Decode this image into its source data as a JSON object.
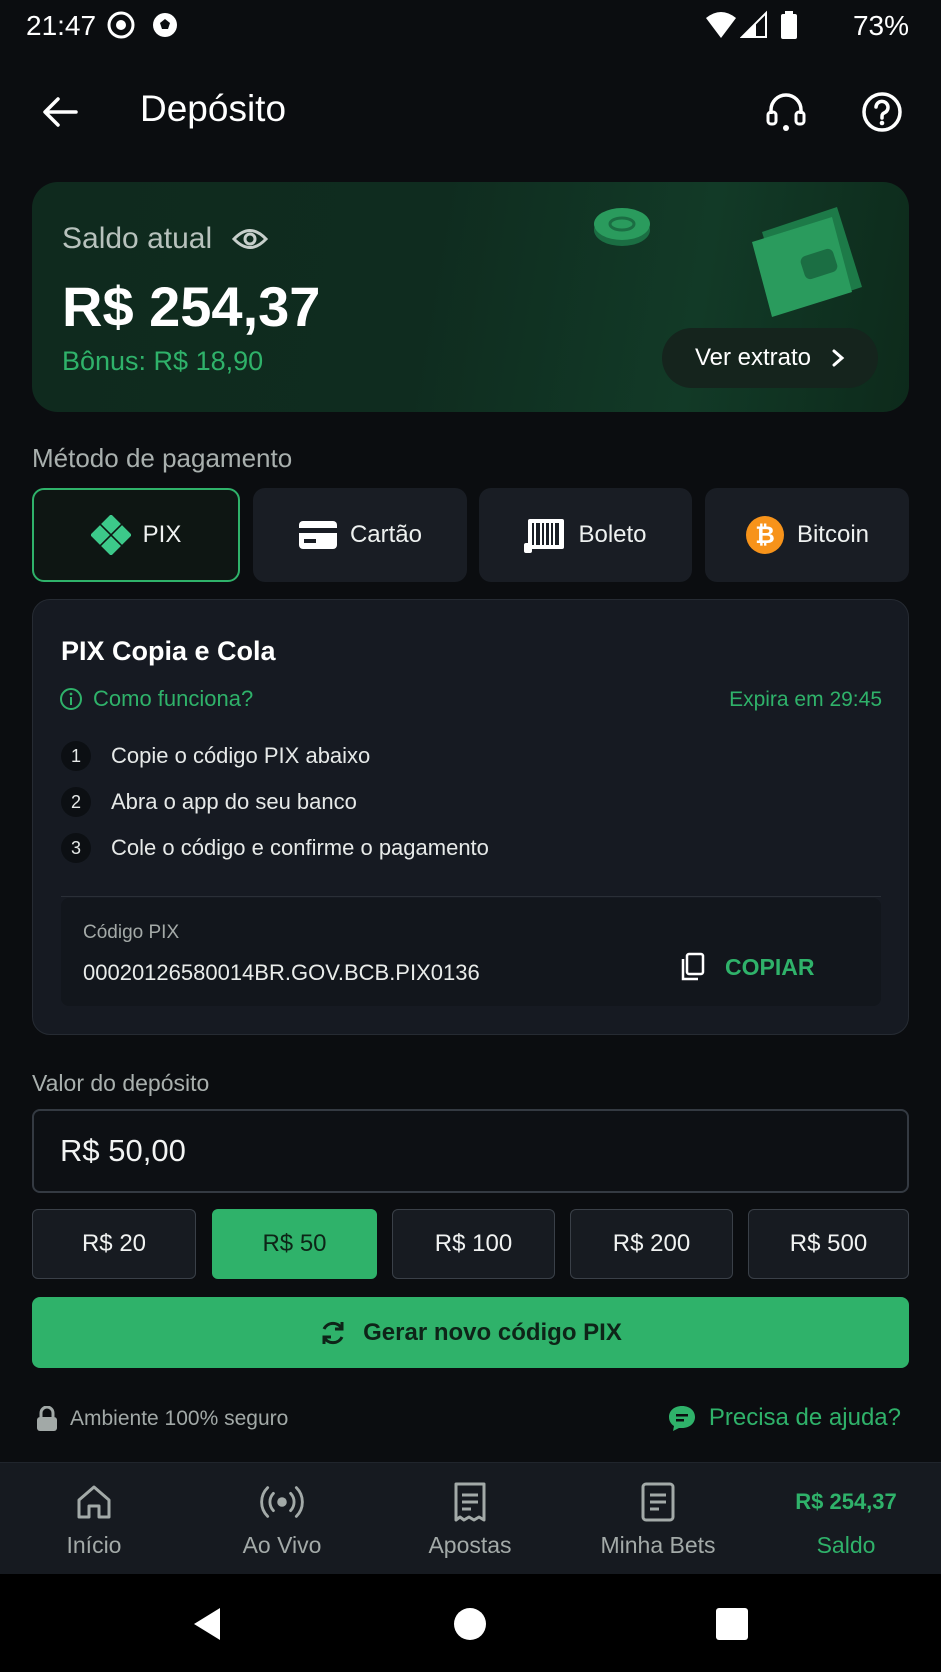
{
  "status_bar": {
    "time": "21:47",
    "battery": "73%"
  },
  "header": {
    "title": "Depósito"
  },
  "balance": {
    "label": "Saldo atual",
    "value": "R$ 254,37",
    "bonus": "Bônus: R$ 18,90",
    "statement_button": "Ver extrato"
  },
  "payment": {
    "section_label": "Método de pagamento",
    "methods": [
      {
        "label": "PIX",
        "icon": "pix-icon",
        "selected": true
      },
      {
        "label": "Cartão",
        "icon": "card-icon",
        "selected": false
      },
      {
        "label": "Boleto",
        "icon": "barcode-icon",
        "selected": false
      },
      {
        "label": "Bitcoin",
        "icon": "bitcoin-icon",
        "selected": false
      }
    ]
  },
  "pix": {
    "title": "PIX Copia e Cola",
    "how_link": "Como funciona?",
    "expires": "Expira em 29:45",
    "steps": [
      {
        "num": "1",
        "text": "Copie o código PIX abaixo"
      },
      {
        "num": "2",
        "text": "Abra o app do seu banco"
      },
      {
        "num": "3",
        "text": "Cole o código e confirme o pagamento"
      }
    ],
    "code_label": "Código PIX",
    "code_value": "00020126580014BR.GOV.BCB.PIX0136",
    "copy_label": "COPIAR"
  },
  "deposit": {
    "label": "Valor do depósito",
    "value": "R$ 50,00",
    "chips": [
      {
        "label": "R$ 20",
        "selected": false
      },
      {
        "label": "R$ 50",
        "selected": true
      },
      {
        "label": "R$ 100",
        "selected": false
      },
      {
        "label": "R$ 200",
        "selected": false
      },
      {
        "label": "R$ 500",
        "selected": false
      }
    ],
    "generate_button": "Gerar novo código PIX"
  },
  "footer": {
    "secure": "Ambiente 100% seguro",
    "help": "Precisa de ajuda?"
  },
  "bottom_nav": {
    "items": [
      {
        "label": "Início",
        "icon": "home-icon"
      },
      {
        "label": "Ao Vivo",
        "icon": "live-icon"
      },
      {
        "label": "Apostas",
        "icon": "bets-icon"
      },
      {
        "label": "Minha Bets",
        "icon": "my-bets-icon"
      },
      {
        "label": "Saldo",
        "icon": "balance-icon",
        "balance": "R$ 254,37",
        "active": true
      }
    ]
  },
  "colors": {
    "accent": "#2fb26a",
    "background": "#0b0d10",
    "card": "#161a22"
  }
}
